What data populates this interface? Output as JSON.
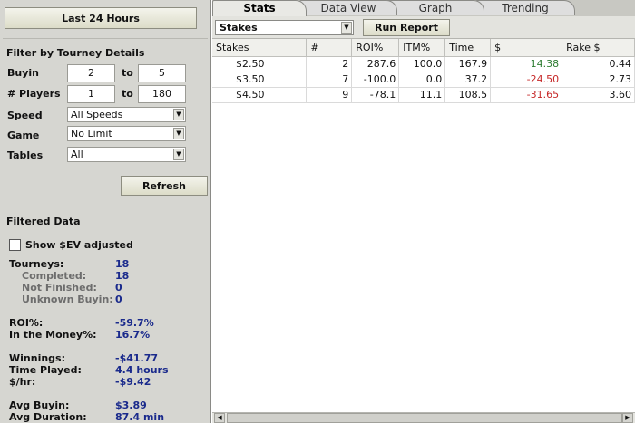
{
  "left": {
    "last_button": "Last 24 Hours",
    "filter_title": "Filter by Tourney Details",
    "buyin": {
      "label": "Buyin",
      "min": "2",
      "to": "to",
      "max": "5"
    },
    "players": {
      "label": "# Players",
      "min": "1",
      "to": "to",
      "max": "180"
    },
    "speed": {
      "label": "Speed",
      "value": "All Speeds"
    },
    "game": {
      "label": "Game",
      "value": "No Limit"
    },
    "tables": {
      "label": "Tables",
      "value": "All"
    },
    "refresh": "Refresh",
    "filtered_title": "Filtered Data",
    "show_ev": "Show $EV adjusted",
    "stats": [
      {
        "label": "Tourneys:",
        "value": "18"
      },
      {
        "label": "Completed:",
        "value": "18"
      },
      {
        "label": "Not Finished:",
        "value": "0"
      },
      {
        "label": "Unknown Buyin:",
        "value": "0"
      },
      {
        "label": "ROI%:",
        "value": "-59.7%"
      },
      {
        "label": "In the Money%:",
        "value": "16.7%"
      },
      {
        "label": "Winnings:",
        "value": "-$41.77"
      },
      {
        "label": "Time Played:",
        "value": "4.4 hours"
      },
      {
        "label": "$/hr:",
        "value": "-$9.42"
      },
      {
        "label": "Avg Buyin:",
        "value": "$3.89"
      },
      {
        "label": "Avg Duration:",
        "value": "87.4 min"
      }
    ]
  },
  "tabs": [
    "Stats",
    "Data View",
    "Graph",
    "Trending"
  ],
  "toolbar": {
    "group_by": "Stakes",
    "run_report": "Run Report"
  },
  "table": {
    "columns": [
      "Stakes",
      "#",
      "ROI%",
      "ITM%",
      "Time",
      "$",
      "Rake $"
    ],
    "rows": [
      [
        "$2.50",
        "2",
        "287.6",
        "100.0",
        "167.9",
        "14.38",
        "0.44"
      ],
      [
        "$3.50",
        "7",
        "-100.0",
        "0.0",
        "37.2",
        "-24.50",
        "2.73"
      ],
      [
        "$4.50",
        "9",
        "-78.1",
        "11.1",
        "108.5",
        "-31.65",
        "3.60"
      ]
    ]
  },
  "colors": {
    "positive": "#2e7d32",
    "negative": "#c62828",
    "stat_value": "#1a2a8c"
  },
  "icons": {
    "dropdown": "chevron-down-icon",
    "scroll_left": "arrow-left-icon",
    "scroll_right": "arrow-right-icon"
  }
}
